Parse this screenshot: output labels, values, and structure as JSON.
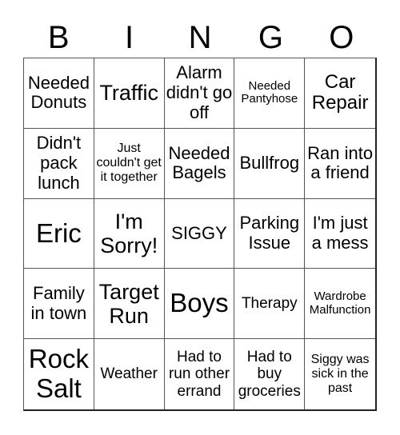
{
  "header": {
    "letters": [
      "B",
      "I",
      "N",
      "G",
      "O"
    ]
  },
  "cells": [
    "Needed Donuts",
    "Traffic",
    "Alarm didn't go off",
    "Needed Pantyhose",
    "Car Repair",
    "Didn't pack lunch",
    "Just couldn't get it together",
    "Needed Bagels",
    "Bullfrog",
    "Ran into a friend",
    "Eric",
    "I'm Sorry!",
    "SIGGY",
    "Parking Issue",
    "I'm just a mess",
    "Family in town",
    "Target Run",
    "Boys",
    "Therapy",
    "Wardrobe Malfunction",
    "Rock Salt",
    "Weather",
    "Had to run other errand",
    "Had to buy groceries",
    "Siggy was sick in the past"
  ]
}
